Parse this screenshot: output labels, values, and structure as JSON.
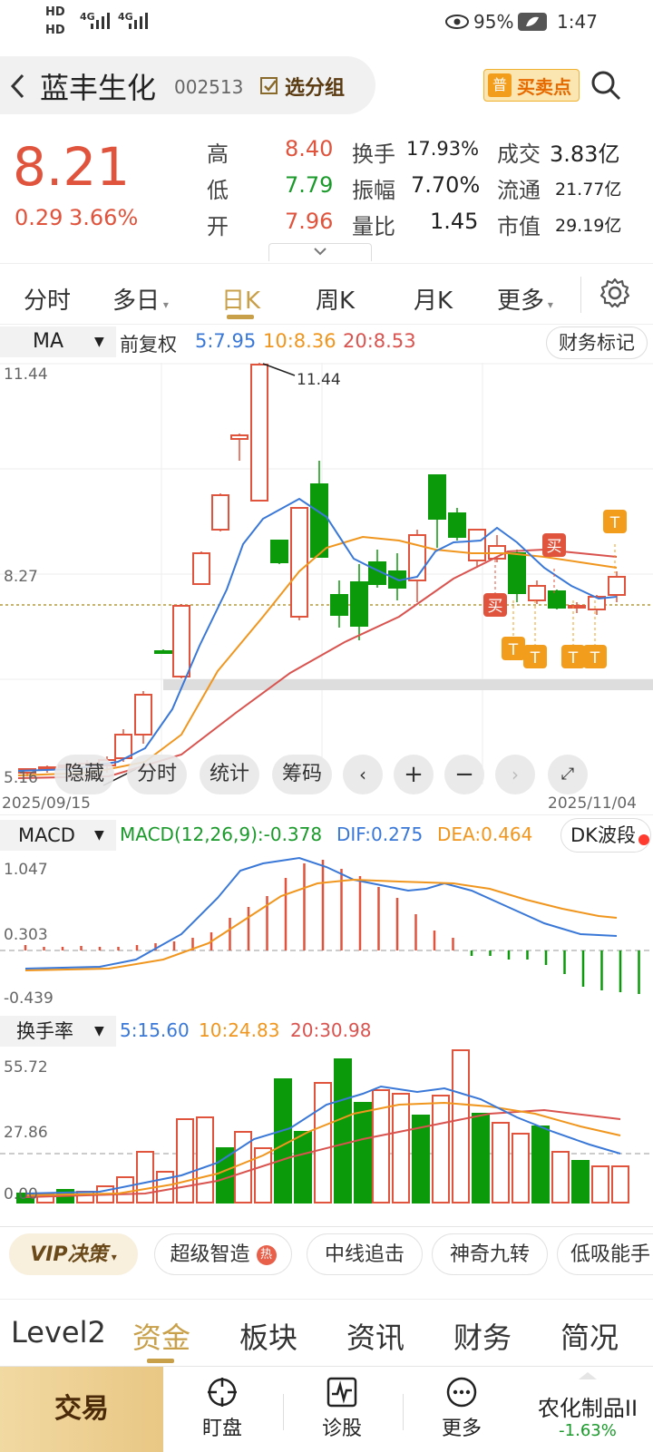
{
  "status": {
    "hd1": "HD",
    "hd2": "HD",
    "net1": "4G",
    "net2": "4G",
    "battery": "95%",
    "time": "1:47"
  },
  "header": {
    "stock_name": "蓝丰生化",
    "stock_code": "002513",
    "group_btn": "选分组",
    "buysell_badge": "普",
    "buysell_label": "买卖点"
  },
  "quote": {
    "price": "8.21",
    "change": "0.29",
    "change_pct": "3.66%",
    "high_label": "高",
    "high": "8.40",
    "low_label": "低",
    "low": "7.79",
    "open_label": "开",
    "open": "7.96",
    "turnover_label": "换手",
    "turnover": "17.93%",
    "amplitude_label": "振幅",
    "amplitude": "7.70%",
    "volratio_label": "量比",
    "volratio": "1.45",
    "amount_label": "成交",
    "amount": "3.83亿",
    "float_label": "流通",
    "float": "21.77亿",
    "mktcap_label": "市值",
    "mktcap": "29.19亿"
  },
  "tabs": [
    "分时",
    "多日",
    "日K",
    "周K",
    "月K",
    "更多"
  ],
  "active_tab": "日K",
  "ma_bar": {
    "selector": "MA",
    "adjust": "前复权",
    "ma5": "5:7.95",
    "ma10": "10:8.36",
    "ma20": "20:8.53",
    "finance_btn": "财务标记"
  },
  "kline": {
    "y_top": "11.44",
    "y_mid": "8.27",
    "y_bottom": "5.16",
    "max_label": "11.44",
    "date_start": "2025/09/15",
    "date_end": "2025/11/04",
    "buy_marker": "买",
    "t_marker": "T"
  },
  "toolbar": {
    "hide": "隐藏",
    "fenshi": "分时",
    "stats": "统计",
    "chips": "筹码"
  },
  "macd": {
    "selector": "MACD",
    "macd": "MACD(12,26,9):-0.378",
    "dif": "DIF:0.275",
    "dea": "DEA:0.464",
    "dk_btn": "DK波段",
    "y_top": "1.047",
    "y_mid": "0.303",
    "y_bottom": "-0.439"
  },
  "turnover": {
    "selector": "换手率",
    "ma5": "5:15.60",
    "ma10": "10:24.83",
    "ma20": "20:30.98",
    "y_top": "55.72",
    "y_mid": "27.86",
    "y_bottom": "0.00"
  },
  "vip": {
    "label": "VIP决策",
    "chips": [
      "超级智造",
      "中线追击",
      "神奇九转",
      "低吸能手"
    ],
    "hot_badge": "热"
  },
  "subtabs": [
    "Level2",
    "资金",
    "板块",
    "资讯",
    "财务",
    "简况"
  ],
  "active_subtab": "资金",
  "bottom": {
    "trade": "交易",
    "watch": "盯盘",
    "diagnose": "诊股",
    "more": "更多",
    "sector": "农化制品II",
    "sector_change": "-1.63%"
  },
  "colors": {
    "up": "#e0533c",
    "down": "#0a9a0a",
    "ma5": "#3a78d8",
    "ma10": "#f0961e",
    "ma20": "#d9534f",
    "accent": "#c9a04a"
  }
}
